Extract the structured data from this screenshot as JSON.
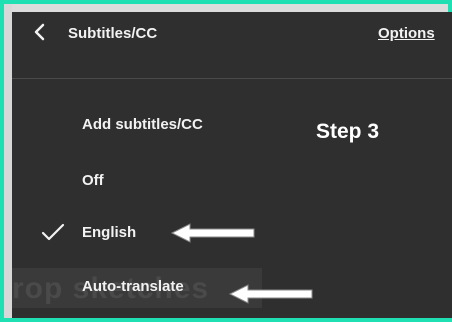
{
  "header": {
    "back_icon": "chevron-left-icon",
    "title": "Subtitles/CC",
    "options_label": "Options"
  },
  "menu": {
    "items": [
      {
        "label": "Add subtitles/CC",
        "selected": false
      },
      {
        "label": "Off",
        "selected": false
      },
      {
        "label": "English",
        "selected": true
      },
      {
        "label": "Auto-translate",
        "selected": false
      }
    ]
  },
  "annotation": {
    "step_label": "Step 3"
  },
  "background": {
    "watermark_text": "rop sketches"
  },
  "colors": {
    "frame_border": "#1ee0b3",
    "menu_background": "#2f2f2f",
    "text": "#f2f2f2",
    "annotation_arrow": "#ffffff"
  }
}
